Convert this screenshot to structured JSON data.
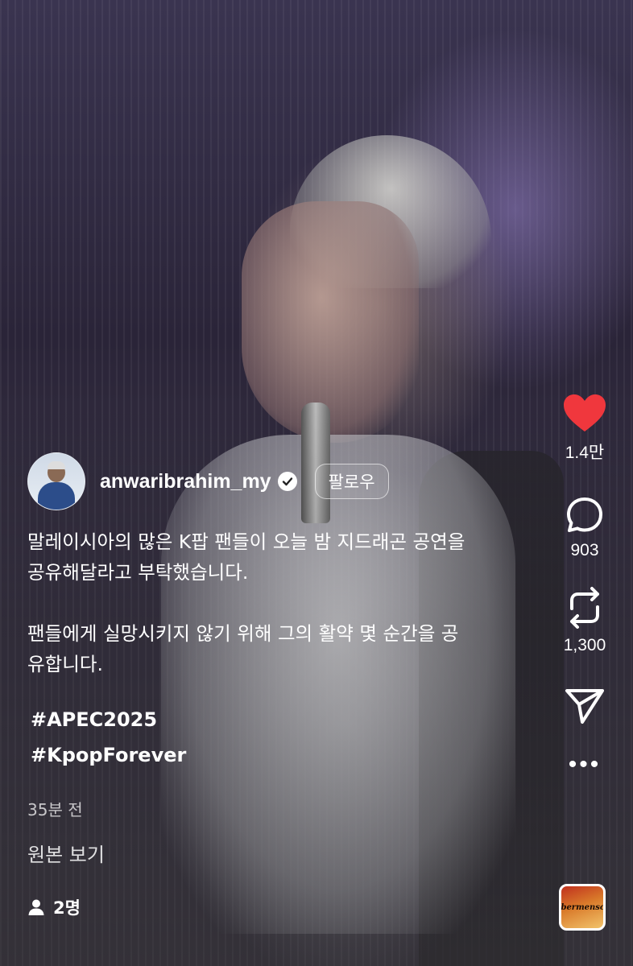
{
  "post": {
    "username": "anwaribrahim_my",
    "follow_label": "팔로우",
    "caption_line1": "말레이시아의 많은 K팝 팬들이 오늘 밤 지드래곤 공연을",
    "caption_line2": "공유해달라고 부탁했습니다.",
    "caption_line3": "팬들에게 실망시키지 않기 위해 그의 활약 몇 순간을 공",
    "caption_line4": "유합니다.",
    "hashtags": [
      "#APEC2025",
      "#KpopForever"
    ],
    "time": "35분 전",
    "view_original": "원본 보기",
    "viewers": "2명"
  },
  "actions": {
    "likes": "1.4만",
    "comments": "903",
    "reposts": "1,300"
  },
  "music": {
    "label": "Übermensch"
  },
  "colors": {
    "like": "#f0373d"
  }
}
